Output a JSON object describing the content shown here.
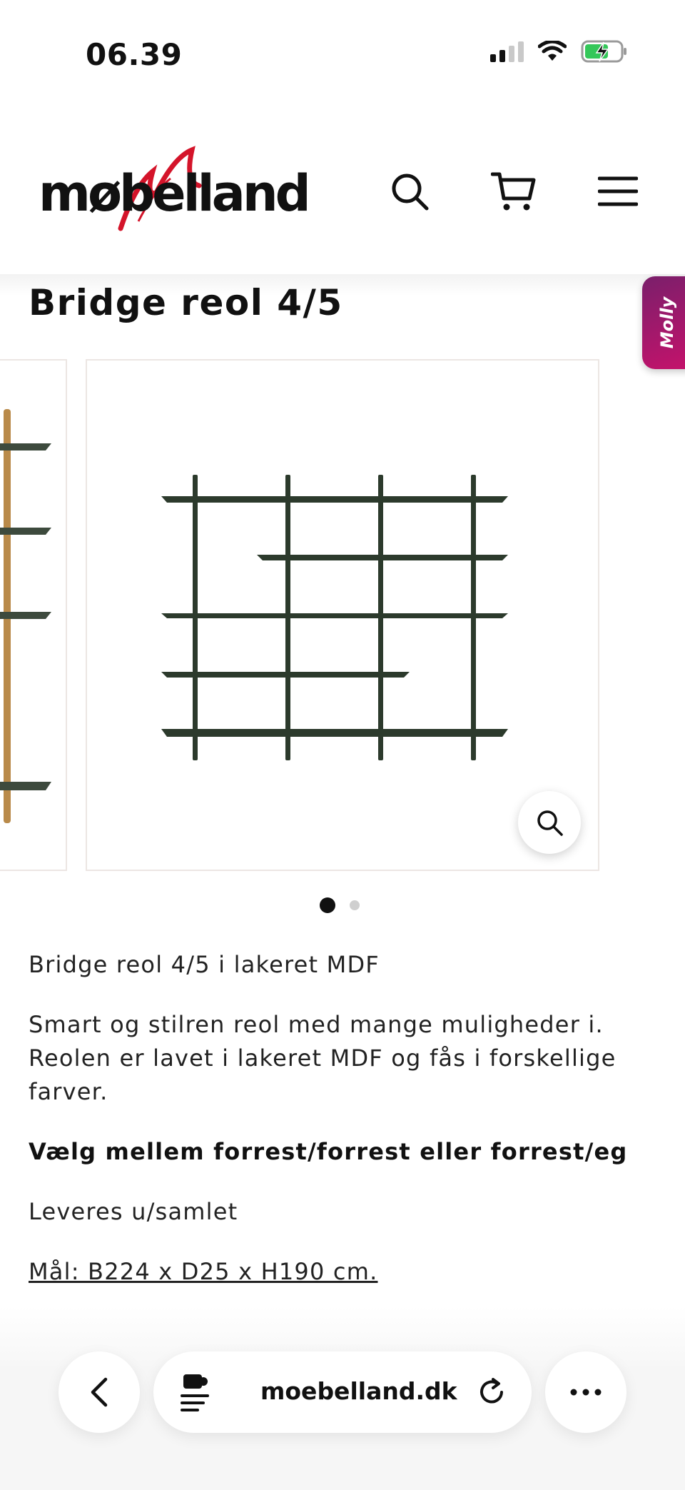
{
  "status_bar": {
    "time": "06.39",
    "icons": [
      "signal-icon",
      "wifi-icon",
      "battery-charging-icon"
    ]
  },
  "header": {
    "logo_text": "møbelland",
    "icons": [
      "search-icon",
      "cart-icon",
      "menu-icon"
    ]
  },
  "product": {
    "title": "Bridge reol 4/5",
    "gallery": {
      "active_index": 0,
      "total_slides": 2
    },
    "description": {
      "subtitle": "Bridge reol 4/5 i lakeret MDF",
      "body": "Smart og stilren reol med mange muligheder i. Reolen er lavet i lakeret MDF og fås i forskellige farver.",
      "choice": "Vælg mellem forrest/forrest eller forrest/eg",
      "delivery": "Leveres u/samlet",
      "dimensions": "Mål: B224 x D25 x H190 cm. "
    }
  },
  "chat_widget": {
    "label": "Molly"
  },
  "browser": {
    "url": "moebelland.dk",
    "icons": [
      "back-icon",
      "reader-icon",
      "reload-icon",
      "more-icon"
    ]
  },
  "colors": {
    "accent_red": "#d4142a",
    "shelf_green": "#2c3a2c",
    "wood": "#b98a4a",
    "molly_gradient_start": "#7a1f6b",
    "molly_gradient_end": "#c5126b"
  }
}
